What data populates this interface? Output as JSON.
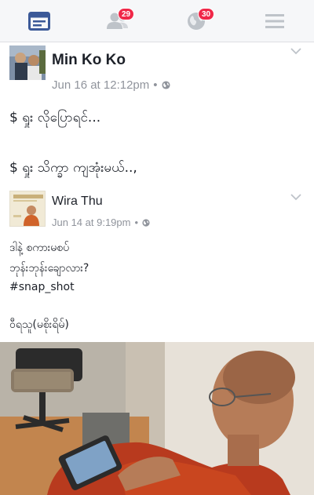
{
  "nav": {
    "items": [
      {
        "name": "news-feed",
        "icon": "news-feed-icon",
        "active": true
      },
      {
        "name": "friend-requests",
        "icon": "friends-icon",
        "badge": "29"
      },
      {
        "name": "notifications",
        "icon": "globe-icon",
        "badge": "30"
      },
      {
        "name": "menu",
        "icon": "menu-icon"
      }
    ],
    "colors": {
      "active": "#3b5998",
      "inactive": "#bec3c9",
      "badge": "#f02849"
    }
  },
  "post": {
    "author": "Min Ko Ko",
    "timestamp": "Jun 16 at 12:12pm",
    "separator": "•",
    "privacy_icon": "globe-icon",
    "lines": [
      "$ ရှုး လိုပြောရင်...",
      "$ ရှုး သိက္ခာ ကျအုံးမယ်..,"
    ]
  },
  "shared": {
    "author": "Wira Thu",
    "timestamp": "Jun 14 at 9:19pm",
    "separator": "•",
    "privacy_icon": "globe-icon",
    "lines": [
      "ဒါနဲ့ စကားမစပ်",
      "ဘုန်းဘုန်းချောလား?",
      "#snap_shot",
      "ဝီရသူ(မစိုးရိမ်)"
    ]
  }
}
